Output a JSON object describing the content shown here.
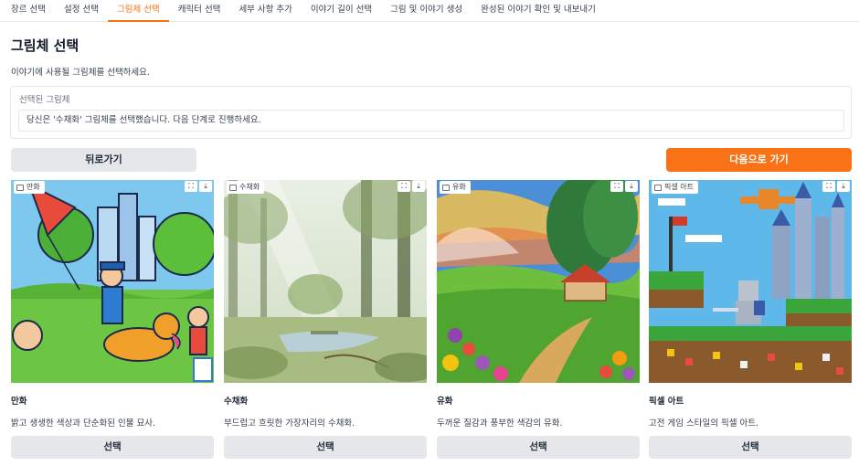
{
  "tabs": [
    "장르 선택",
    "설정 선택",
    "그림체 선택",
    "캐릭터 선택",
    "세부 사항 추가",
    "이야기 길이 선택",
    "그림 및 이야기 생성",
    "완성된 이야기 확인 및 내보내기"
  ],
  "active_tab_index": 2,
  "page": {
    "title": "그림체 선택",
    "description": "이야기에 사용될 그림체를 선택하세요."
  },
  "selected": {
    "label": "선택된 그림체",
    "value": "당신은 '수채화' 그림체를 선택했습니다. 다음 단계로 진행하세요."
  },
  "buttons": {
    "back": "뒤로가기",
    "next": "다음으로 가기"
  },
  "styles": [
    {
      "badge": "만화",
      "name": "만화",
      "description": "밝고 생생한 색상과 단순화된 인물 묘사.",
      "button": "선택"
    },
    {
      "badge": "수채화",
      "name": "수채화",
      "description": "부드럽고 흐릿한 가장자리의 수채화.",
      "button": "선택"
    },
    {
      "badge": "유화",
      "name": "유화",
      "description": "두꺼운 질감과 풍부한 색감의 유화.",
      "button": "선택"
    },
    {
      "badge": "픽셀 아트",
      "name": "픽셀 아트",
      "description": "고전 게임 스타일의 픽셀 아트.",
      "button": "선택"
    }
  ],
  "image_tools": {
    "fullscreen": "⛶",
    "download": "⤓"
  },
  "colors": {
    "accent": "#f97316",
    "button_gray": "#e5e7eb"
  }
}
